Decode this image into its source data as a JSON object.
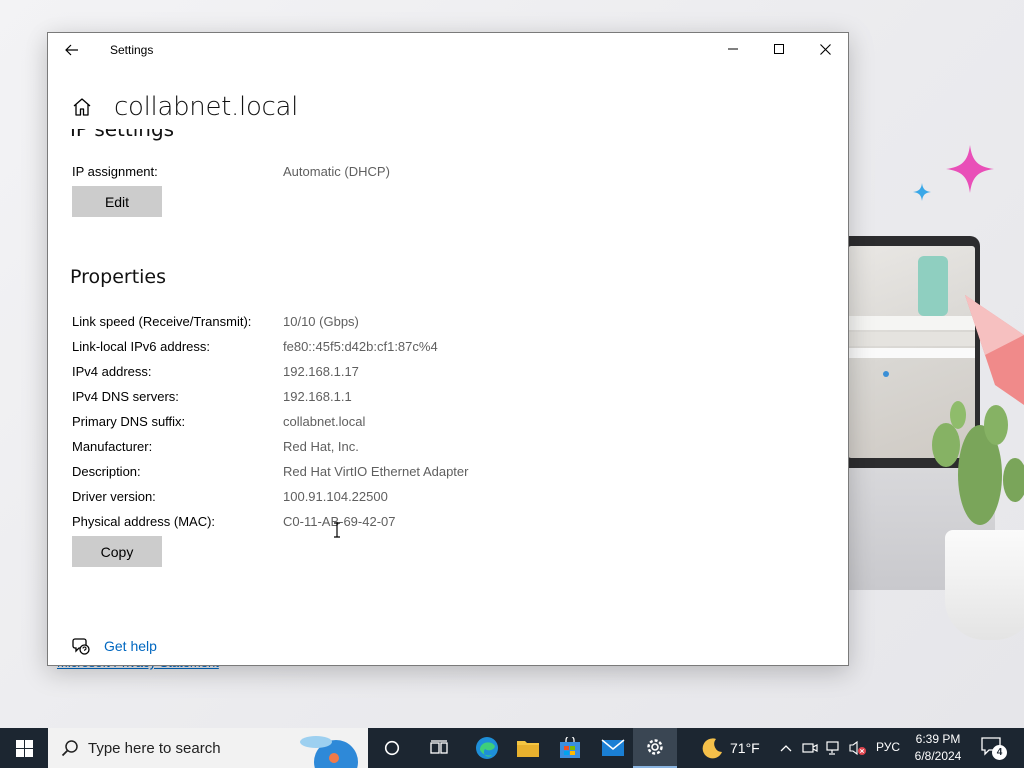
{
  "window": {
    "app_title": "Settings",
    "page_title": "collabnet.local"
  },
  "ip_settings": {
    "section_title": "IP settings",
    "assignment_label": "IP assignment:",
    "assignment_value": "Automatic (DHCP)",
    "edit_label": "Edit"
  },
  "properties": {
    "section_title": "Properties",
    "rows": [
      {
        "label": "Link speed (Receive/Transmit):",
        "value": "10/10 (Gbps)"
      },
      {
        "label": "Link-local IPv6 address:",
        "value": "fe80::45f5:d42b:cf1:87c%4"
      },
      {
        "label": "IPv4 address:",
        "value": "192.168.1.17"
      },
      {
        "label": "IPv4 DNS servers:",
        "value": "192.168.1.1"
      },
      {
        "label": "Primary DNS suffix:",
        "value": "collabnet.local"
      },
      {
        "label": "Manufacturer:",
        "value": "Red Hat, Inc."
      },
      {
        "label": "Description:",
        "value": "Red Hat VirtIO Ethernet Adapter"
      },
      {
        "label": "Driver version:",
        "value": "100.91.104.22500"
      },
      {
        "label": "Physical address (MAC):",
        "value": "C0-11-AB-69-42-07"
      }
    ],
    "copy_label": "Copy"
  },
  "help": {
    "link_label": "Get help"
  },
  "background": {
    "privacy_link": "Microsoft Privacy Statement"
  },
  "taskbar": {
    "search_placeholder": "Type here to search",
    "weather_temp": "71°F",
    "language": "РУС",
    "time": "6:39 PM",
    "date": "6/8/2024",
    "notification_count": "4",
    "apps": [
      "cortana-icon",
      "task-view-icon",
      "edge-icon",
      "file-explorer-icon",
      "store-icon",
      "mail-icon",
      "settings-icon"
    ]
  },
  "colors": {
    "accent_link": "#0067c0",
    "button_bg": "#cccccc",
    "taskbar_bg": "#1c2631",
    "value_text": "#5f5f5f"
  }
}
